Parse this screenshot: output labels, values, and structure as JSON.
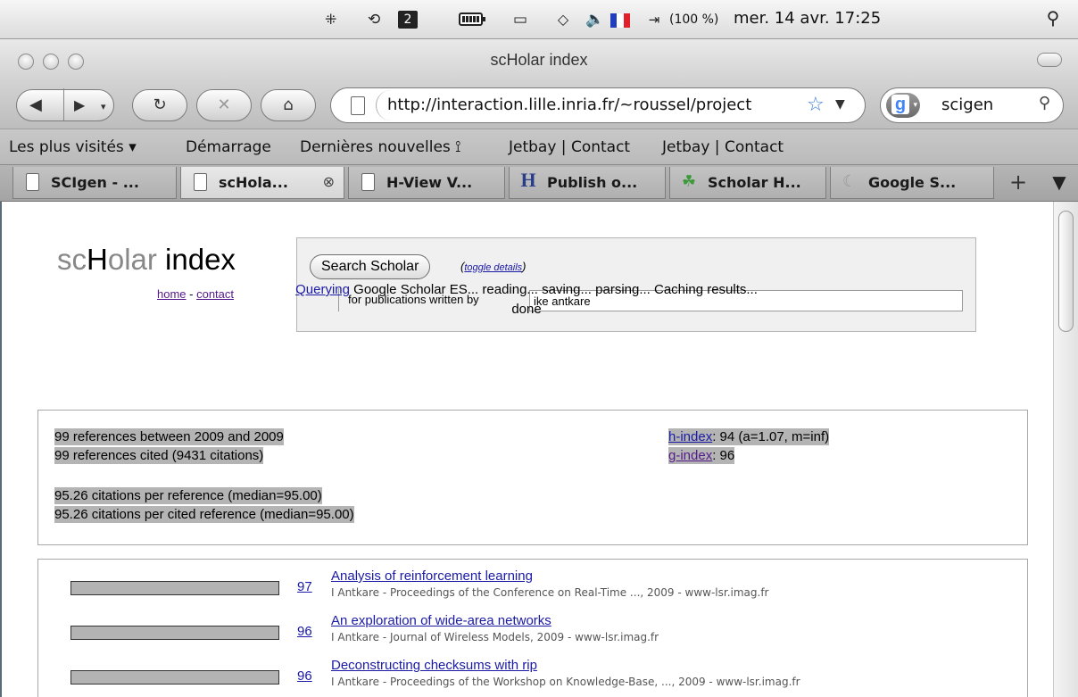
{
  "menubar": {
    "battery_percent": "(100 %)",
    "datetime": "mer. 14 avr. 17:25",
    "flag_colors": [
      "#1f3fbf",
      "#ffffff",
      "#e0202a"
    ]
  },
  "window": {
    "title": "scHolar index"
  },
  "toolbar": {
    "url": "http://interaction.lille.inria.fr/~roussel/project",
    "search_value": "scigen"
  },
  "bookmarks": [
    {
      "label": "Les plus visités ▾"
    },
    {
      "label": "Démarrage"
    },
    {
      "label": "Dernières nouvelles ⟟"
    },
    {
      "label": "Jetbay | Contact"
    },
    {
      "label": "Jetbay | Contact"
    }
  ],
  "tabs": [
    {
      "label": "SCIgen - ...",
      "icon": "page-icon"
    },
    {
      "label": "scHola...",
      "icon": "page-icon",
      "active": true
    },
    {
      "label": "H-View V...",
      "icon": "page-icon"
    },
    {
      "label": "Publish o...",
      "icon": "h-icon"
    },
    {
      "label": "Scholar H...",
      "icon": "leaf-icon"
    },
    {
      "label": "Google S...",
      "icon": "moon-icon"
    }
  ],
  "page": {
    "logo": {
      "part1": "sc",
      "part2": "H",
      "part3": "olar",
      "part4": " index"
    },
    "links": {
      "home": "home",
      "sep": " - ",
      "contact": "contact"
    },
    "search": {
      "button": "Search Scholar",
      "toggle_open": "(",
      "toggle_link": "toggle details",
      "toggle_close": ")",
      "author_label": "for publications written by",
      "author_value": "ike antkare"
    },
    "status": {
      "link": "Querying",
      "rest": " Google Scholar ES... reading... saving... parsing... Caching results...",
      "done": "done"
    },
    "stats": {
      "refs_between": "99 references between 2009 and 2009",
      "refs_cited": "99 references cited (9431 citations)",
      "cit_per_ref": "95.26 citations per reference (median=95.00)",
      "cit_per_cited": "95.26 citations per cited reference (median=95.00)",
      "h_link": "h-index",
      "h_value": ": 94 (a=1.07, m=inf)",
      "g_link": "g-index",
      "g_value": ": 96"
    },
    "results": [
      {
        "count": "97",
        "title": "Analysis of reinforcement learning",
        "meta": "I Antkare - Proceedings of the Conference on Real-Time ..., 2009 - www-lsr.imag.fr"
      },
      {
        "count": "96",
        "title": "An exploration of wide-area networks",
        "meta": "I Antkare - Journal of Wireless Models, 2009 - www-lsr.imag.fr"
      },
      {
        "count": "96",
        "title": "Deconstructing checksums with rip",
        "meta": "I Antkare - Proceedings of the Workshop on Knowledge-Base, ..., 2009 - www-lsr.imag.fr"
      }
    ]
  }
}
